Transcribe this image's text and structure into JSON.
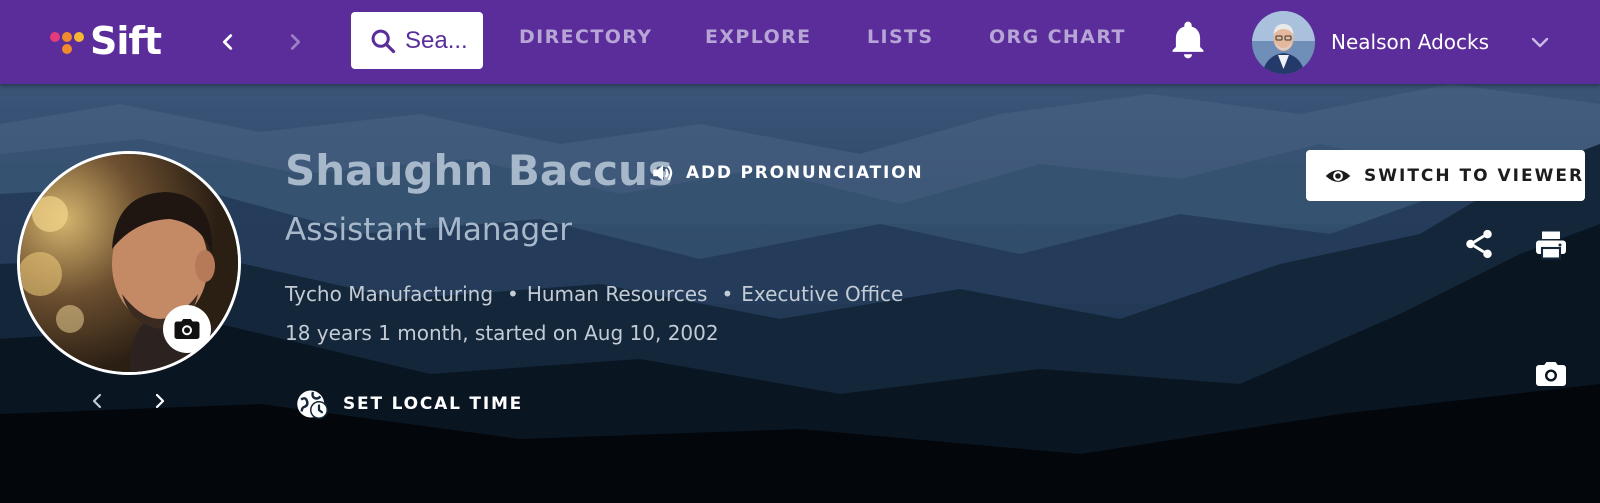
{
  "brand": {
    "name": "Sift",
    "dot_colors": [
      "#e63b7a",
      "#f08a2c",
      "#c23bbf",
      "#f7b733"
    ]
  },
  "nav": {
    "search_placeholder": "Sea...",
    "links": [
      "DIRECTORY",
      "EXPLORE",
      "LISTS",
      "ORG CHART"
    ],
    "user_name": "Nealson Adocks"
  },
  "profile": {
    "name": "Shaughn Baccus",
    "pronunciation_label": "ADD PRONUNCIATION",
    "title": "Assistant Manager",
    "company": "Tycho Manufacturing",
    "department": "Human Resources",
    "office": "Executive Office",
    "tenure": "18 years 1 month, started on Aug 10, 2002",
    "local_time_label": "SET LOCAL TIME",
    "switch_viewer_label": "SWITCH TO VIEWER"
  },
  "colors": {
    "nav_bg": "#5b2d9a",
    "nav_link": "#b7a5d6",
    "name_text": "#a7b8cb"
  },
  "icons": [
    "search-icon",
    "chevron-left-icon",
    "chevron-right-icon",
    "bell-icon",
    "chevron-down-icon",
    "speaker-icon",
    "camera-icon",
    "globe-clock-icon",
    "eye-icon",
    "share-icon",
    "print-icon"
  ]
}
